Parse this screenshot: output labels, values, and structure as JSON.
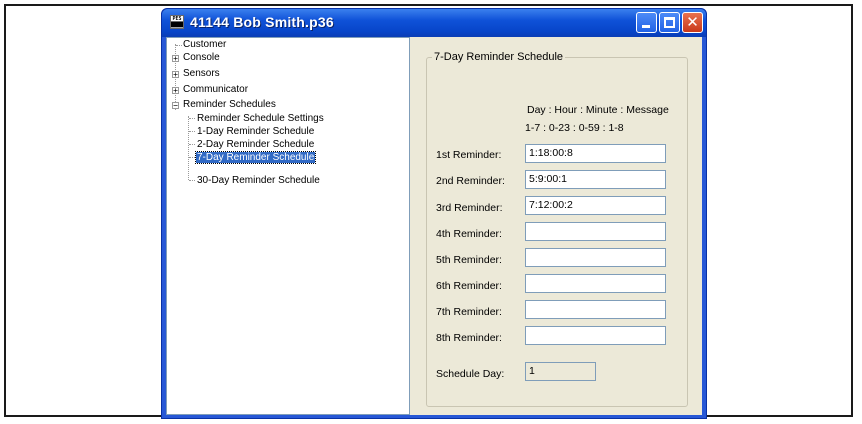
{
  "window": {
    "title": "41144 Bob Smith.p36",
    "icon_text": "PES ████"
  },
  "tree": {
    "items": [
      {
        "label": "Customer"
      },
      {
        "label": "Console",
        "expander": "+"
      },
      {
        "label": "Sensors",
        "expander": "+"
      },
      {
        "label": "Communicator",
        "expander": "+"
      },
      {
        "label": "Reminder Schedules",
        "expander": "−",
        "children": [
          {
            "label": "Reminder Schedule Settings"
          },
          {
            "label": "1-Day Reminder Schedule"
          },
          {
            "label": "2-Day Reminder Schedule"
          },
          {
            "label": "7-Day Reminder Schedule"
          },
          {
            "label": "30-Day Reminder Schedule"
          }
        ]
      }
    ],
    "selected": "7-Day Reminder Schedule"
  },
  "panel": {
    "group_title": "7-Day Reminder Schedule",
    "header_fields": "Day : Hour : Minute : Message",
    "header_ranges": "1-7  : 0-23  :  0-59   : 1-8",
    "reminders": [
      {
        "label": "1st Reminder:",
        "value": "1:18:00:8"
      },
      {
        "label": "2nd Reminder:",
        "value": "5:9:00:1"
      },
      {
        "label": "3rd Reminder:",
        "value": "7:12:00:2"
      },
      {
        "label": "4th Reminder:",
        "value": ""
      },
      {
        "label": "5th Reminder:",
        "value": ""
      },
      {
        "label": "6th Reminder:",
        "value": ""
      },
      {
        "label": "7th Reminder:",
        "value": ""
      },
      {
        "label": "8th Reminder:",
        "value": ""
      }
    ],
    "schedule_day_label": "Schedule Day:",
    "schedule_day_value": "1"
  }
}
